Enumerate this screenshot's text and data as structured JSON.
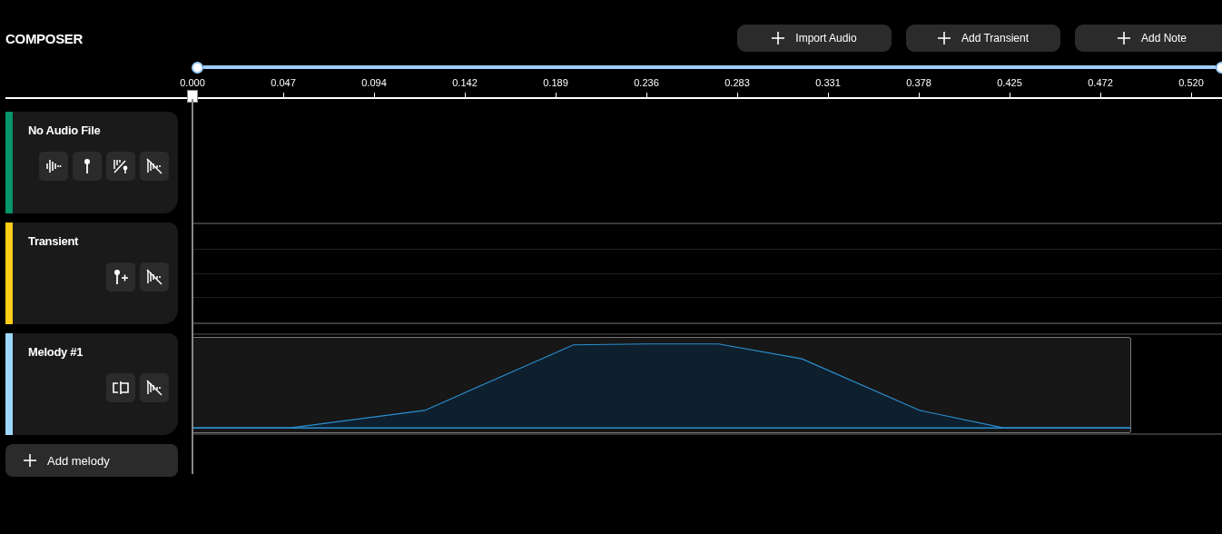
{
  "title": "COMPOSER",
  "actions": [
    {
      "label": "Import Audio"
    },
    {
      "label": "Add Transient"
    },
    {
      "label": "Add Note"
    }
  ],
  "range": {
    "level": 1
  },
  "ruler": {
    "ticks": [
      "0.000",
      "0.047",
      "0.094",
      "0.142",
      "0.189",
      "0.236",
      "0.283",
      "0.331",
      "0.378",
      "0.425",
      "0.472",
      "0.520"
    ]
  },
  "tracks": [
    {
      "kind": "audio",
      "name": "No Audio File",
      "color": "#07956a",
      "tools": [
        {
          "kind": "waveform"
        },
        {
          "kind": "pin"
        },
        {
          "kind": "bars-pin"
        },
        {
          "kind": "mute"
        }
      ]
    },
    {
      "kind": "transient",
      "name": "Transient",
      "color": "#ffcc17",
      "tools": [
        {
          "kind": "pin-plus"
        },
        {
          "kind": "mute"
        }
      ]
    },
    {
      "kind": "melody",
      "name": "Melody #1",
      "color": "#9fd8ff",
      "tools": [
        {
          "kind": "split"
        },
        {
          "kind": "mute"
        }
      ]
    }
  ],
  "add_button": {
    "label": "Add melody"
  }
}
